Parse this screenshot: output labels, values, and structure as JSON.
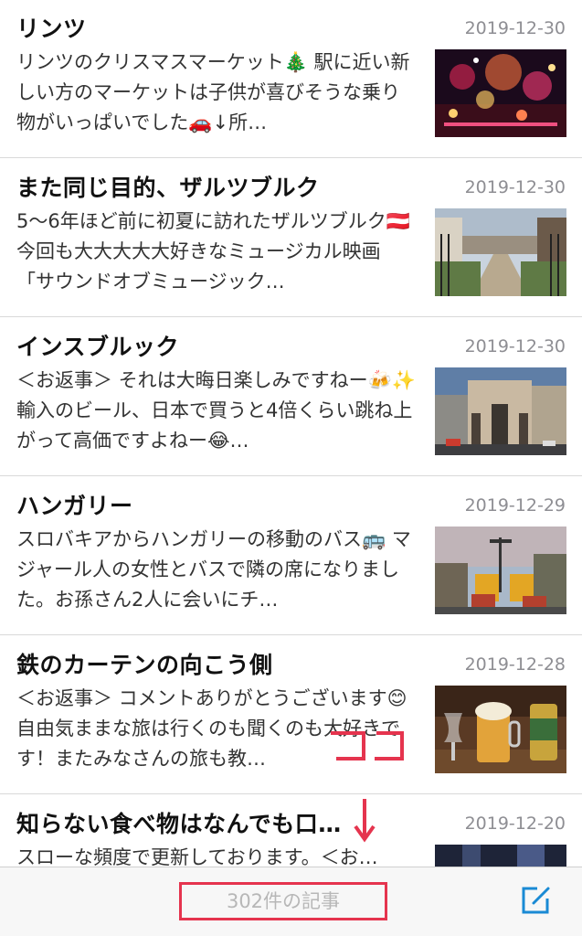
{
  "articles": [
    {
      "title": "リンツ",
      "date": "2019-12-30",
      "excerpt": "リンツのクリスマスマーケット🎄 駅に近い新しい方のマーケットは子供が喜びそうな乗り物がいっぱいでした🚗↓所…",
      "thumbnail": "christmas-market-night-photo"
    },
    {
      "title": "また同じ目的、ザルツブルク",
      "date": "2019-12-30",
      "excerpt": "5〜6年ほど前に初夏に訪れたザルツブルク🇦🇹 今回も大大大大大好きなミュージカル映画「サウンドオブミュージック…",
      "thumbnail": "mirabell-garden-photo"
    },
    {
      "title": "インスブルック",
      "date": "2019-12-30",
      "excerpt": "＜お返事＞ それは大晦日楽しみですねー🍻✨ 輸入のビール、日本で買うと4倍くらい跳ね上がって高価ですよねー😂…",
      "thumbnail": "triumphal-arch-photo"
    },
    {
      "title": "ハンガリー",
      "date": "2019-12-29",
      "excerpt": "スロバキアからハンガリーの移動のバス🚌 マジャール人の女性とバスで隣の席になりました。お孫さん2人に会いにチ…",
      "thumbnail": "tram-street-photo"
    },
    {
      "title": "鉄のカーテンの向こう側",
      "date": "2019-12-28",
      "excerpt": "＜お返事＞ コメントありがとうございます😊 自由気ままな旅は行くのも聞くのも大好きです！またみなさんの旅も教…",
      "thumbnail": "beer-glasses-photo"
    },
    {
      "title": "知らない食べ物はなんでも口…",
      "date": "2019-12-20",
      "excerpt": "スローな頻度で更新しております。＜お…",
      "thumbnail": "dark-photo"
    }
  ],
  "toolbar": {
    "count_label": "302件の記事",
    "compose_icon": "compose-icon"
  },
  "annotation": {
    "highlight_color": "#e5344e",
    "mark": "ココ"
  }
}
